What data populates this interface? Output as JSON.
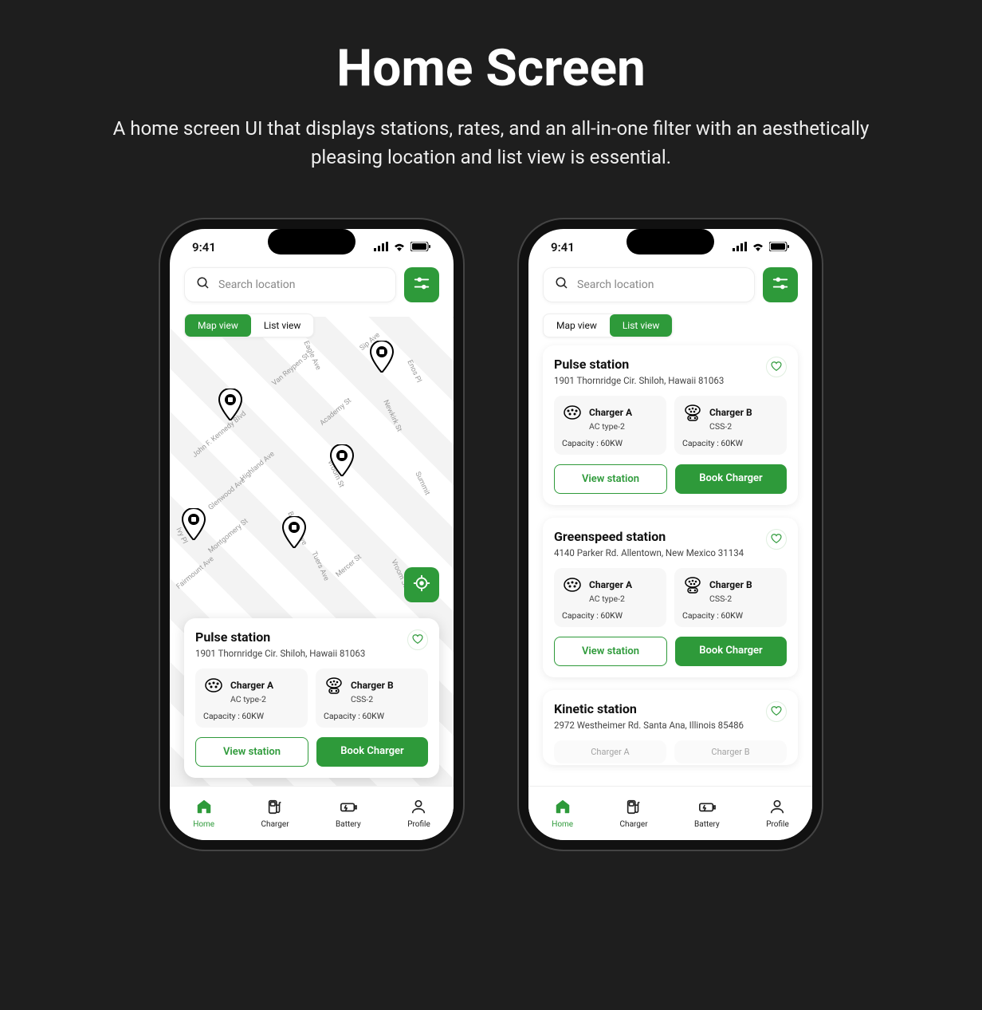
{
  "page": {
    "title": "Home Screen",
    "subtitle": "A home screen UI that displays stations, rates, and an all-in-one filter with an aesthetically pleasing location and list view is essential."
  },
  "statusbar": {
    "time": "9:41"
  },
  "search": {
    "placeholder": "Search location"
  },
  "view_tabs": {
    "map": "Map view",
    "list": "List view"
  },
  "streets": [
    "Sip Ave",
    "Eagle Ave",
    "Enos Pl",
    "Van Reypen St",
    "Newkirk St",
    "John F. Kennedy Blvd",
    "Academy St",
    "Highland Ave",
    "Vroom St",
    "Summit",
    "Glenwood Ave",
    "Bergen Ave",
    "Vroom St",
    "Montgomery St",
    "Ivy Pl",
    "Tuers Ave",
    "Mercer St",
    "Fairmount Ave"
  ],
  "stations": {
    "pulse": {
      "name": "Pulse station",
      "address": "1901 Thornridge Cir. Shiloh, Hawaii 81063",
      "chargers": [
        {
          "name": "Charger A",
          "type": "AC type-2",
          "capacity": "Capacity : 60KW"
        },
        {
          "name": "Charger B",
          "type": "CSS-2",
          "capacity": "Capacity : 60KW"
        }
      ]
    },
    "greenspeed": {
      "name": "Greenspeed station",
      "address": "4140 Parker Rd. Allentown, New Mexico 31134",
      "chargers": [
        {
          "name": "Charger A",
          "type": "AC type-2",
          "capacity": "Capacity : 60KW"
        },
        {
          "name": "Charger B",
          "type": "CSS-2",
          "capacity": "Capacity : 60KW"
        }
      ]
    },
    "kinetic": {
      "name": "Kinetic station",
      "address": "2972 Westheimer Rd. Santa Ana, Illinois 85486",
      "chargers": [
        {
          "name": "Charger A"
        },
        {
          "name": "Charger B"
        }
      ]
    }
  },
  "buttons": {
    "view": "View station",
    "book": "Book Charger"
  },
  "tabbar": {
    "home": "Home",
    "charger": "Charger",
    "battery": "Battery",
    "profile": "Profile"
  },
  "colors": {
    "accent": "#2e9a3a"
  }
}
